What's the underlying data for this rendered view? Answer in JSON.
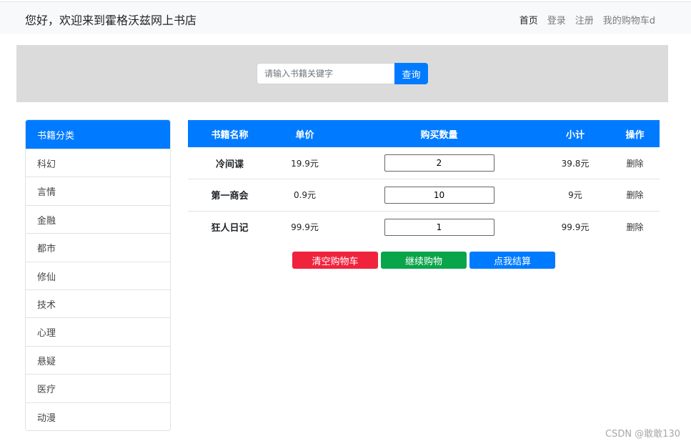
{
  "navbar": {
    "brand": "您好，欢迎来到霍格沃兹网上书店",
    "links": [
      "首页",
      "登录",
      "注册",
      "我的购物车d"
    ]
  },
  "search": {
    "placeholder": "请输入书籍关键字",
    "button_label": "查询"
  },
  "categories": {
    "header": "书籍分类",
    "items": [
      "科幻",
      "言情",
      "金融",
      "都市",
      "修仙",
      "技术",
      "心理",
      "悬疑",
      "医疗",
      "动漫"
    ]
  },
  "cart": {
    "columns": [
      "书籍名称",
      "单价",
      "购买数量",
      "小计",
      "操作"
    ],
    "rows": [
      {
        "name": "冷间谍",
        "price": "19.9元",
        "qty": "2",
        "subtotal": "39.8元",
        "action": "删除"
      },
      {
        "name": "第一商会",
        "price": "0.9元",
        "qty": "10",
        "subtotal": "9元",
        "action": "删除"
      },
      {
        "name": "狂人日记",
        "price": "99.9元",
        "qty": "1",
        "subtotal": "99.9元",
        "action": "删除"
      }
    ],
    "buttons": {
      "clear": "清空购物车",
      "continue": "继续购物",
      "checkout": "点我结算"
    }
  },
  "colors": {
    "primary": "#007bff",
    "danger": "#f0233d",
    "success": "#0aa54a",
    "band": "#dbdbdb"
  },
  "watermark": "CSDN @敢敢130"
}
